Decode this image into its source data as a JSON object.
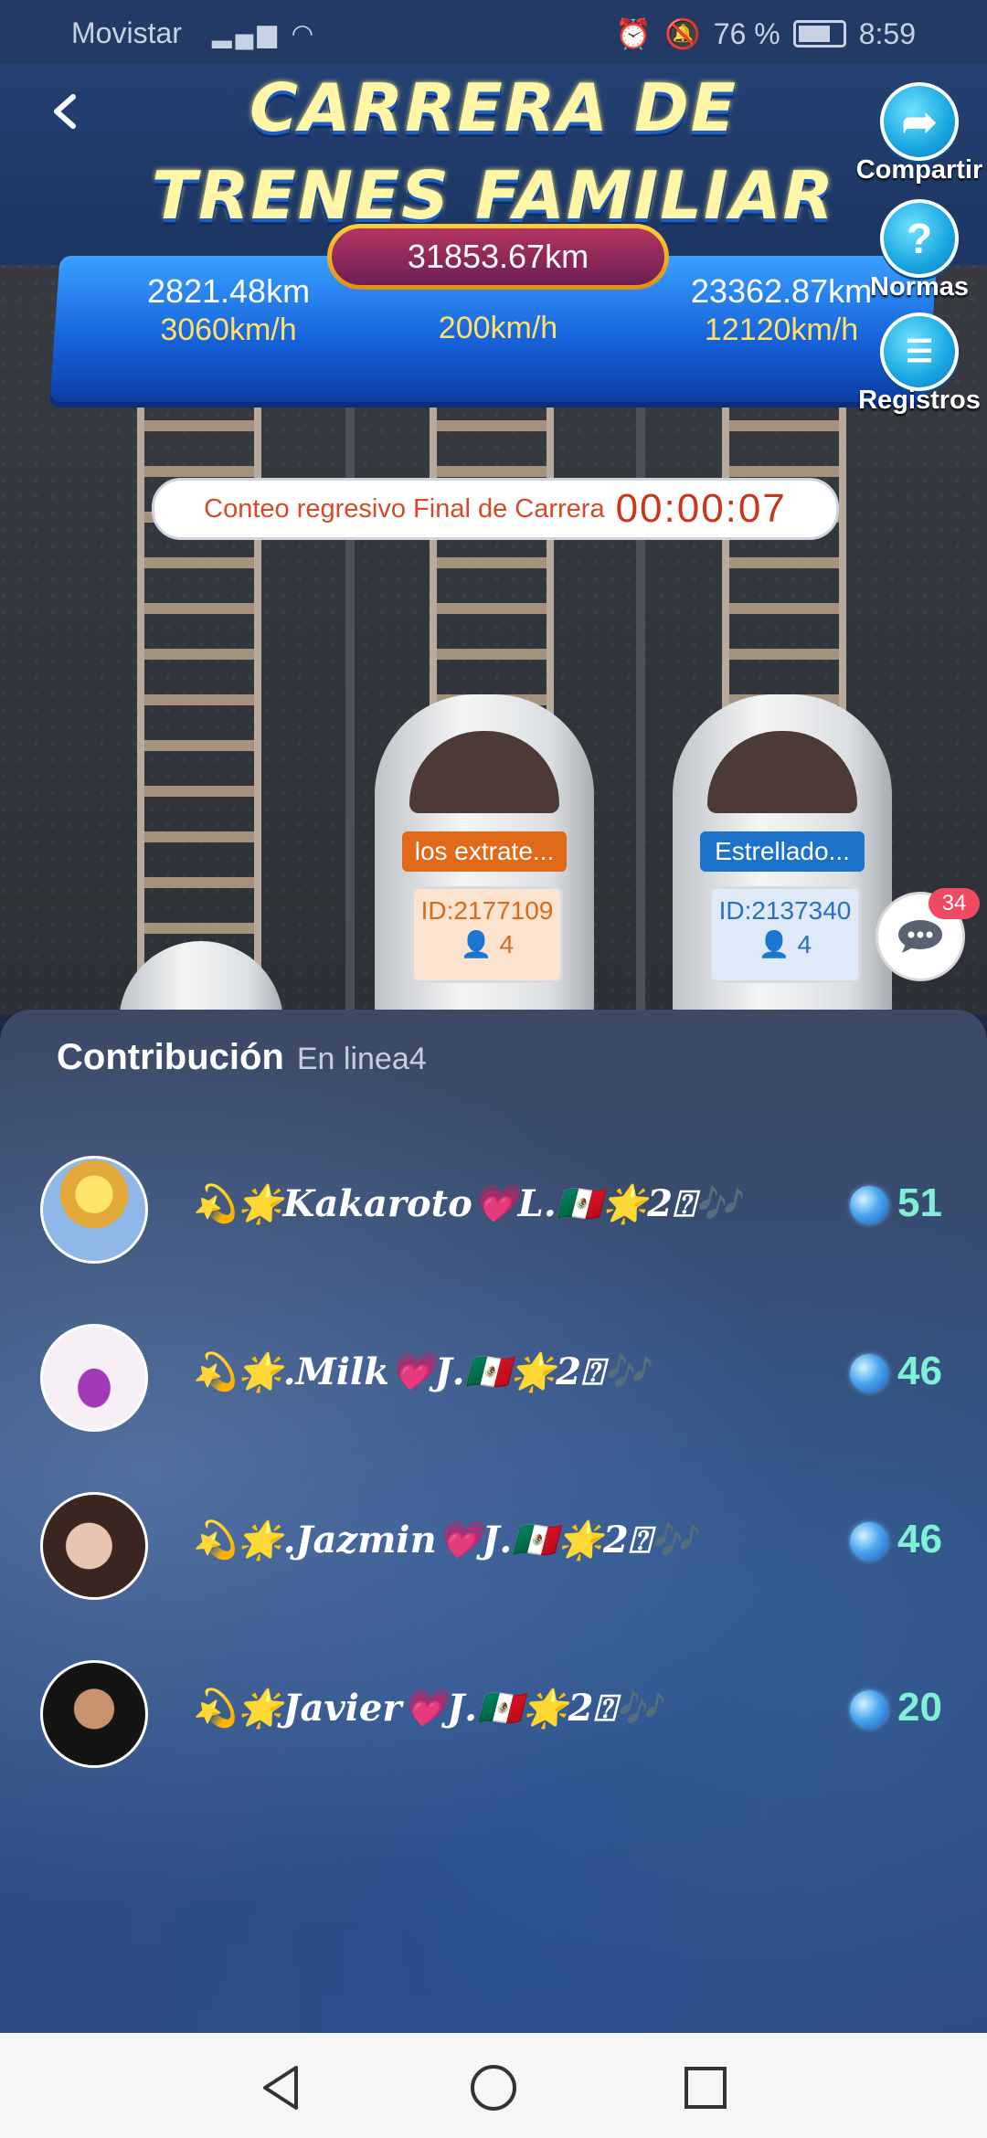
{
  "status_bar": {
    "carrier": "Movistar",
    "battery": "76 %",
    "time": "8:59"
  },
  "header": {
    "title_line1": "CARRERA DE",
    "title_line2": "TRENES FAMILIAR",
    "total_distance": "31853.67km"
  },
  "lanes": [
    {
      "distance": "2821.48km",
      "speed": "3060km/h"
    },
    {
      "distance": "",
      "speed": "200km/h"
    },
    {
      "distance": "23362.87km",
      "speed": "12120km/h"
    }
  ],
  "countdown": {
    "label": "Conteo regresivo Final de Carrera",
    "time": "00:00:07"
  },
  "side_buttons": {
    "share": "Compartir",
    "rules": "Normas",
    "records": "Registros"
  },
  "trains": [
    {
      "name": "los extrate...",
      "id": "ID:2177109",
      "members": "4",
      "plate_color": "#e06a1a",
      "text_color": "#d86a1c",
      "box_bg": "#fbe3cf"
    },
    {
      "name": "Estrellado...",
      "id": "ID:2137340",
      "members": "4",
      "plate_color": "#1d73c9",
      "text_color": "#2a6fc0",
      "box_bg": "#dfeaf8"
    }
  ],
  "chat": {
    "badge": "34"
  },
  "contribution": {
    "title": "Contribución",
    "subtitle": "En linea4",
    "rows": [
      {
        "name": "💫🌟𝑲𝒂𝒌𝒂𝒓𝒐𝒕𝒐💗𝑳.🇲🇽🌟2⍰🎶",
        "score": "51"
      },
      {
        "name": "💫🌟.𝑴𝒊𝒍𝒌💗𝑱.🇲🇽🌟2⍰🎶",
        "score": "46"
      },
      {
        "name": "💫🌟.𝑱𝒂𝒛𝒎𝒊𝒏💗𝑱.🇲🇽🌟2⍰🎶",
        "score": "46"
      },
      {
        "name": "💫🌟𝑱𝒂𝒗𝒊𝒆𝒓💗𝑱.🇲🇽🌟2⍰🎶",
        "score": "20"
      }
    ]
  }
}
